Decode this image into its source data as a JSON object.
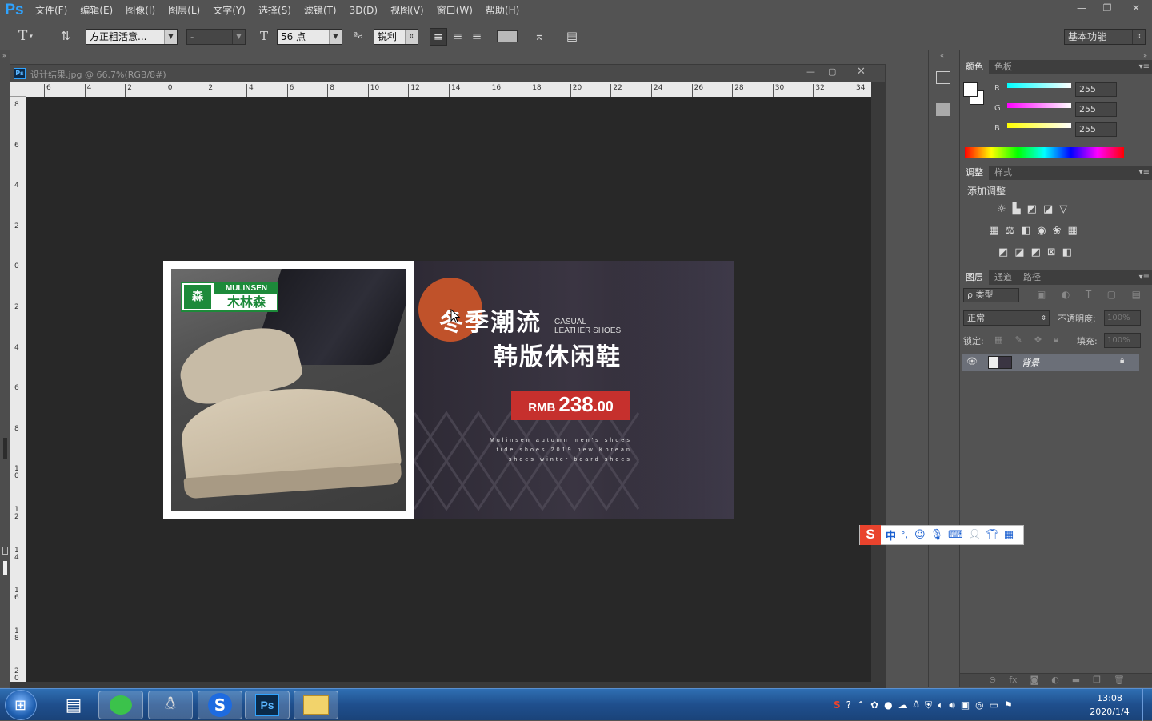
{
  "app": {
    "logo": "Ps"
  },
  "menu": [
    "文件(F)",
    "编辑(E)",
    "图像(I)",
    "图层(L)",
    "文字(Y)",
    "选择(S)",
    "滤镜(T)",
    "3D(D)",
    "视图(V)",
    "窗口(W)",
    "帮助(H)"
  ],
  "options": {
    "tool_icon": "T",
    "font_family": "方正粗活意...",
    "font_style": "-",
    "font_size": "56 点",
    "aa_label": "ªa",
    "antialias": "锐利",
    "workspace": "基本功能"
  },
  "document": {
    "title": "设计结果.jpg @ 66.7%(RGB/8#)",
    "ps_badge": "Ps",
    "hruler_labels": [
      "6",
      "4",
      "2",
      "0",
      "2",
      "4",
      "6",
      "8",
      "10",
      "12",
      "14",
      "16",
      "18",
      "20",
      "22",
      "24",
      "26",
      "28",
      "30",
      "32",
      "34"
    ],
    "vruler_labels": [
      "8",
      "6",
      "4",
      "2",
      "0",
      "2",
      "4",
      "6",
      "8",
      "1\n0",
      "1\n2",
      "1\n4",
      "1\n6",
      "1\n8",
      "2\n0"
    ]
  },
  "artwork": {
    "brand_en": "MULINSEN",
    "brand_cn": "木林森",
    "headline_1": "冬季潮流",
    "casual": "CASUAL",
    "leather": "LEATHER SHOES",
    "headline_2": "韩版休闲鞋",
    "price_prefix": "RMB",
    "price": "238",
    "price_cents": ".00",
    "tagline_1": "Mulinsen autumn men's shoes",
    "tagline_2": "tide shoes 2019 new Korean",
    "tagline_3": "shoes winter board shoes"
  },
  "color_panel": {
    "tabs": [
      "颜色",
      "色板"
    ],
    "channels": [
      {
        "label": "R",
        "value": "255"
      },
      {
        "label": "G",
        "value": "255"
      },
      {
        "label": "B",
        "value": "255"
      }
    ]
  },
  "adjust_panel": {
    "tabs": [
      "调整",
      "样式"
    ],
    "heading": "添加调整"
  },
  "layers_panel": {
    "tabs": [
      "图层",
      "通道",
      "路径"
    ],
    "kind_filter": "ρ 类型",
    "blend_mode": "正常",
    "opacity_label": "不透明度:",
    "opacity_value": "100%",
    "lock_label": "锁定:",
    "fill_label": "填充:",
    "fill_value": "100%",
    "layer_name": "背景"
  },
  "ime": {
    "logo": "S",
    "mode": "中",
    "punct": "°,"
  },
  "taskbar": {
    "time": "13:08",
    "date": "2020/1/4",
    "ps_label": "Ps"
  }
}
